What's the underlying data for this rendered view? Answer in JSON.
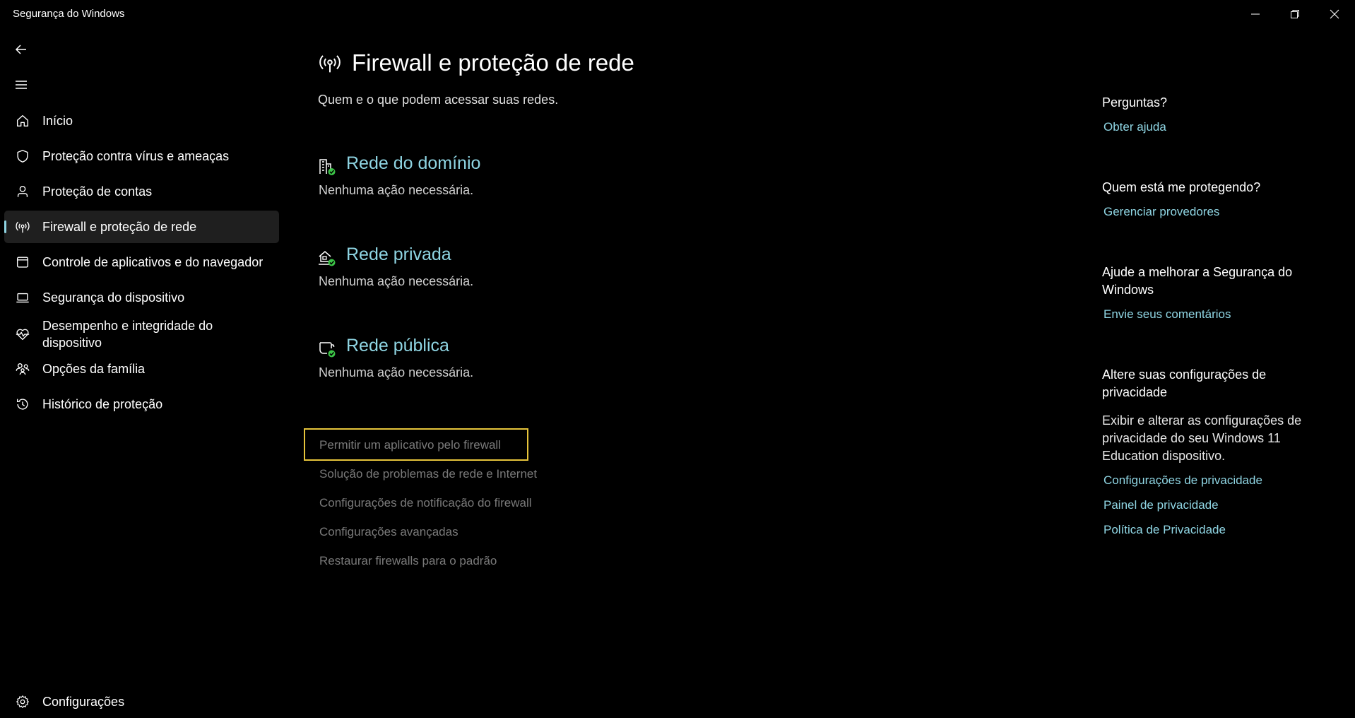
{
  "window": {
    "title": "Segurança do Windows"
  },
  "sidebar": {
    "items": [
      {
        "label": "Início",
        "icon": "home-icon"
      },
      {
        "label": "Proteção contra vírus e ameaças",
        "icon": "shield-icon"
      },
      {
        "label": "Proteção de contas",
        "icon": "person-icon"
      },
      {
        "label": "Firewall e proteção de rede",
        "icon": "wireless-icon",
        "selected": true
      },
      {
        "label": "Controle de aplicativos e do navegador",
        "icon": "app-window-icon"
      },
      {
        "label": "Segurança do dispositivo",
        "icon": "laptop-icon"
      },
      {
        "label": "Desempenho e integridade do dispositivo",
        "icon": "heart-pulse-icon"
      },
      {
        "label": "Opções da família",
        "icon": "family-icon"
      },
      {
        "label": "Histórico de proteção",
        "icon": "history-icon"
      }
    ],
    "settings_label": "Configurações"
  },
  "main": {
    "title": "Firewall e proteção de rede",
    "subtitle": "Quem e o que podem acessar suas redes.",
    "networks": [
      {
        "title": "Rede do domínio",
        "status": "Nenhuma ação necessária.",
        "icon": "domain-network-icon"
      },
      {
        "title": "Rede privada",
        "status": "Nenhuma ação necessária.",
        "icon": "private-network-icon"
      },
      {
        "title": "Rede pública",
        "status": "Nenhuma ação necessária.",
        "icon": "public-network-icon"
      }
    ],
    "links": [
      "Permitir um aplicativo pelo firewall",
      "Solução de problemas de rede e Internet",
      "Configurações de notificação do firewall",
      "Configurações avançadas",
      "Restaurar firewalls para o padrão"
    ]
  },
  "right": {
    "questions_heading": "Perguntas?",
    "get_help": "Obter ajuda",
    "protecting_heading": "Quem está me protegendo?",
    "manage_providers": "Gerenciar provedores",
    "improve_heading": "Ajude a melhorar a Segurança do Windows",
    "send_feedback": "Envie seus comentários",
    "privacy_heading": "Altere suas configurações de privacidade",
    "privacy_text": "Exibir e alterar as configurações de privacidade do seu Windows 11 Education dispositivo.",
    "privacy_settings": "Configurações de privacidade",
    "privacy_dashboard": "Painel de privacidade",
    "privacy_policy": "Política de Privacidade"
  },
  "colors": {
    "accent": "#8fd5e3",
    "focus": "#e6c43b",
    "check": "#3cc447"
  }
}
